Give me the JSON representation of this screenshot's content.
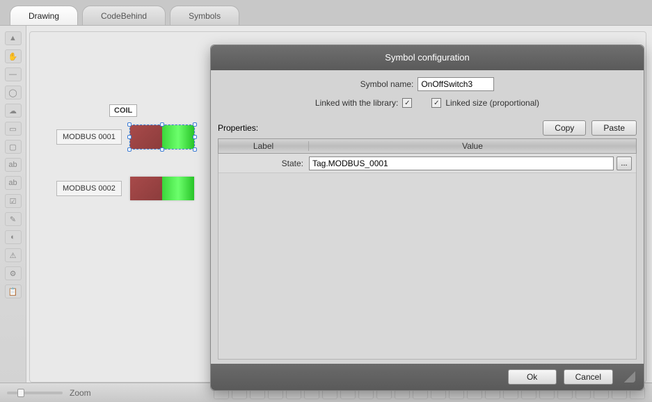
{
  "tabs": [
    {
      "label": "Drawing",
      "active": true
    },
    {
      "label": "CodeBehind",
      "active": false
    },
    {
      "label": "Symbols",
      "active": false
    }
  ],
  "canvas": {
    "coil_title": "COIL",
    "items": [
      {
        "label": "MODBUS 0001",
        "selected": true
      },
      {
        "label": "MODBUS 0002",
        "selected": false
      }
    ]
  },
  "zoom_label": "Zoom",
  "dialog": {
    "title": "Symbol configuration",
    "symbol_name_label": "Symbol name:",
    "symbol_name_value": "OnOffSwitch3",
    "linked_library_label": "Linked with the library:",
    "linked_library_checked": true,
    "linked_size_label": "Linked size (proportional)",
    "linked_size_checked": true,
    "properties_label": "Properties:",
    "copy_label": "Copy",
    "paste_label": "Paste",
    "columns": {
      "label": "Label",
      "value": "Value"
    },
    "rows": [
      {
        "label": "State:",
        "value": "Tag.MODBUS_0001"
      }
    ],
    "browse_label": "...",
    "ok_label": "Ok",
    "cancel_label": "Cancel"
  }
}
